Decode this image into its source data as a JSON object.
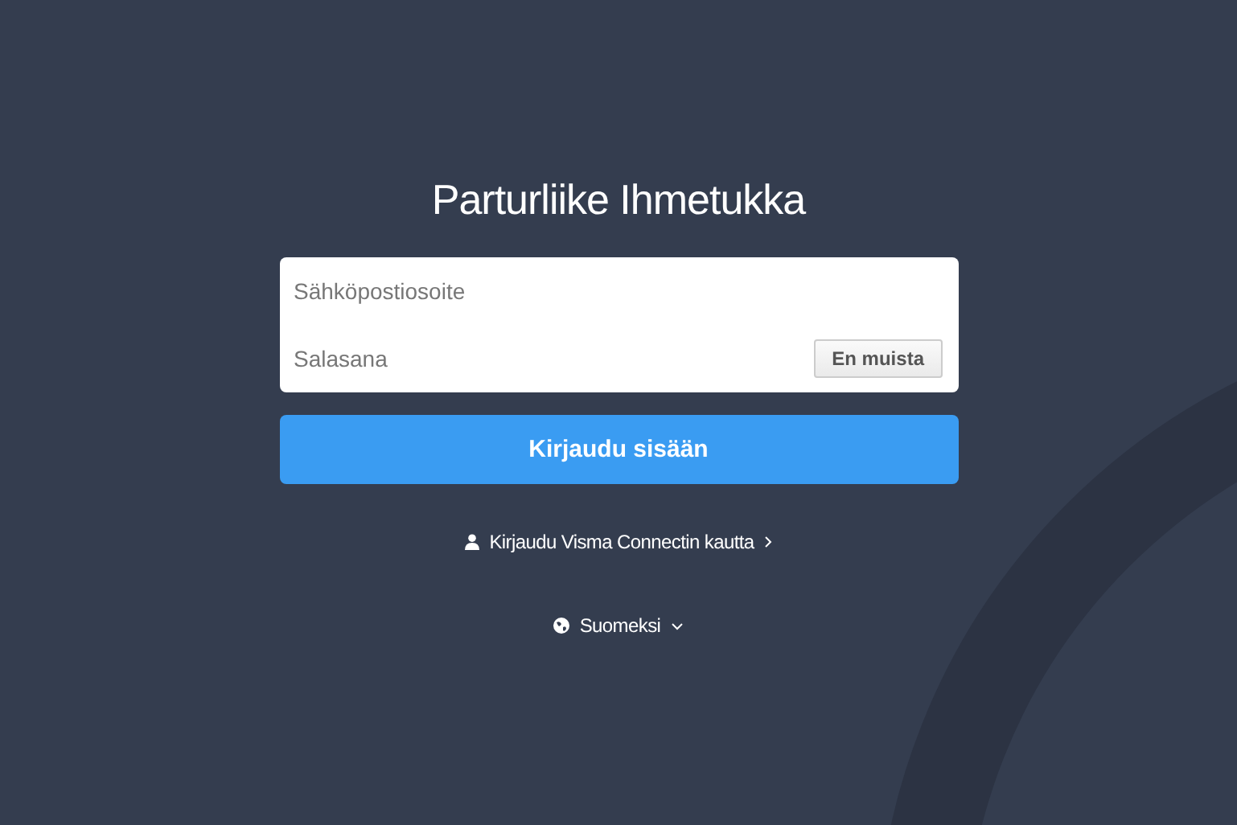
{
  "title": "Parturliike Ihmetukka",
  "form": {
    "email": {
      "placeholder": "Sähköpostiosoite"
    },
    "password": {
      "placeholder": "Salasana"
    },
    "forgot_button": "En muista"
  },
  "login_button": "Kirjaudu sisään",
  "connect_link": "Kirjaudu Visma Connectin kautta",
  "language": "Suomeksi"
}
